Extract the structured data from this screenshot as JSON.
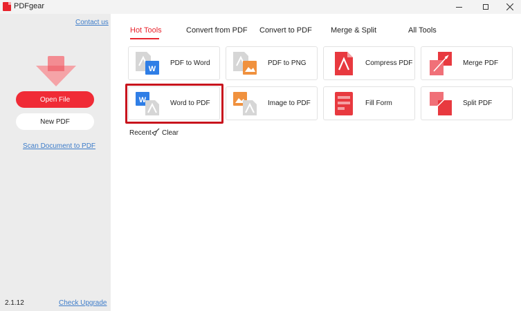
{
  "titlebar": {
    "title": "PDFgear"
  },
  "sidebar": {
    "contact": "Contact us",
    "open_file": "Open File",
    "new_pdf": "New PDF",
    "scan": "Scan Document to PDF",
    "version": "2.1.12",
    "upgrade": "Check Upgrade"
  },
  "tabs": [
    {
      "label": "Hot Tools",
      "active": true
    },
    {
      "label": "Convert from PDF"
    },
    {
      "label": "Convert to PDF"
    },
    {
      "label": "Merge & Split"
    },
    {
      "label": "All Tools"
    }
  ],
  "tools": [
    {
      "label": "PDF to Word",
      "icon": "pdf-to-word-icon"
    },
    {
      "label": "PDF to PNG",
      "icon": "pdf-to-png-icon"
    },
    {
      "label": "Compress PDF",
      "icon": "compress-pdf-icon"
    },
    {
      "label": "Merge PDF",
      "icon": "merge-pdf-icon"
    },
    {
      "label": "Word to PDF",
      "icon": "word-to-pdf-icon"
    },
    {
      "label": "Image to PDF",
      "icon": "image-to-pdf-icon"
    },
    {
      "label": "Fill Form",
      "icon": "fill-form-icon"
    },
    {
      "label": "Split PDF",
      "icon": "split-pdf-icon"
    }
  ],
  "recent": {
    "label": "Recent",
    "clear": "Clear"
  },
  "colors": {
    "accent": "#e8232c",
    "link": "#3d7cc9",
    "highlight": "#c8141d"
  }
}
